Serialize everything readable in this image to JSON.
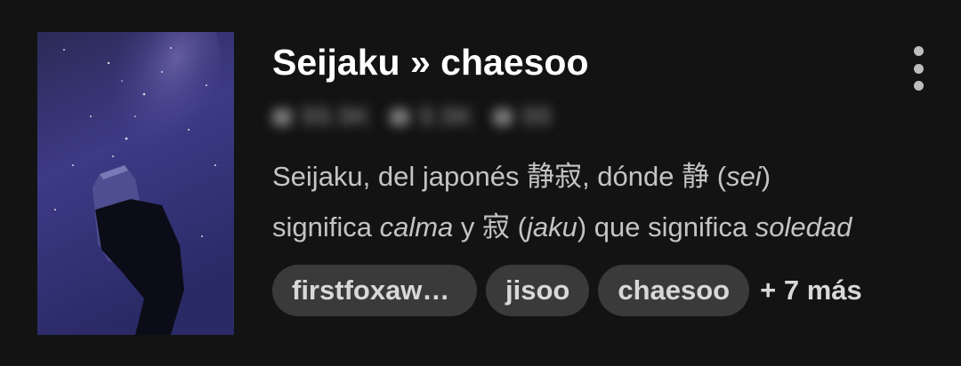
{
  "story": {
    "title": "Seijaku » chaesoo",
    "stats": [
      {
        "icon": "eye-icon",
        "value": "99.9K"
      },
      {
        "icon": "star-icon",
        "value": "9.9K"
      },
      {
        "icon": "list-icon",
        "value": "99"
      }
    ],
    "description": {
      "line1": {
        "a": "Seijaku, del japonés 静寂, dónde 静 (",
        "b": "sei",
        "c": ")"
      },
      "line2": {
        "a": "significa ",
        "b": "calma",
        "c": " y 寂 (",
        "d": "jaku",
        "e": ") que significa ",
        "f": "soledad"
      }
    },
    "tags": [
      "firstfoxawards",
      "jisoo",
      "chaesoo"
    ],
    "more_tags": "+ 7 más"
  },
  "colors": {
    "background": "#131313",
    "tag_bg": "#3a3a3a",
    "text_secondary": "#c4c4c4"
  },
  "icons": {
    "menu": "more-vertical-icon"
  }
}
